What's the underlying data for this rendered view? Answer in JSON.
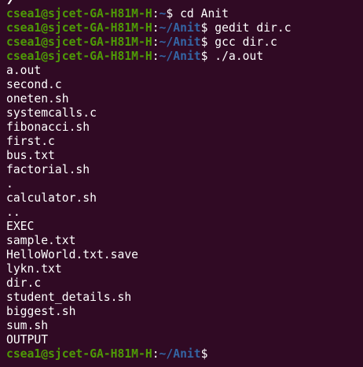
{
  "terminal": {
    "top_fragment": "❯",
    "prompt_user_host": "csea1@sjcet-GA-H81M-H",
    "prompt_colon": ":",
    "prompts": [
      {
        "path": "~",
        "dollar": "$",
        "command": " cd Anit"
      },
      {
        "path": "~/Anit",
        "dollar": "$",
        "command": " gedit dir.c"
      },
      {
        "path": "~/Anit",
        "dollar": "$",
        "command": " gcc dir.c"
      },
      {
        "path": "~/Anit",
        "dollar": "$",
        "command": " ./a.out"
      }
    ],
    "output_lines": [
      "a.out",
      "second.c",
      "oneten.sh",
      "systemcalls.c",
      "fibonacci.sh",
      "first.c",
      "bus.txt",
      "factorial.sh",
      ".",
      "calculator.sh",
      "..",
      "EXEC",
      "sample.txt",
      "HelloWorld.txt.save",
      "lykn.txt",
      "dir.c",
      "student_details.sh",
      "biggest.sh",
      "sum.sh",
      "OUTPUT"
    ],
    "final_prompt": {
      "path": "~/Anit",
      "dollar": "$"
    }
  },
  "colors": {
    "background": "#300a24",
    "user_host": "#4e9a06",
    "path": "#3465a4",
    "text": "#ffffff"
  }
}
